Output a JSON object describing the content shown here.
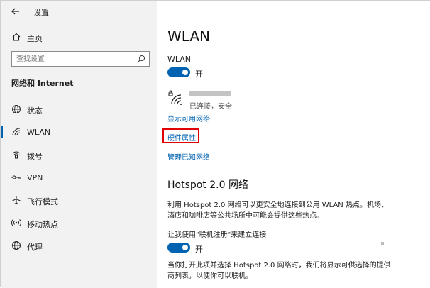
{
  "window": {
    "title": "设置"
  },
  "sidebar": {
    "home_label": "主页",
    "search_placeholder": "查找设置",
    "section_title": "网络和 Internet",
    "items": [
      {
        "label": "状态",
        "icon": "globe-icon"
      },
      {
        "label": "WLAN",
        "icon": "wifi-icon",
        "selected": true
      },
      {
        "label": "拨号",
        "icon": "dialup-icon"
      },
      {
        "label": "VPN",
        "icon": "vpn-icon"
      },
      {
        "label": "飞行模式",
        "icon": "airplane-icon"
      },
      {
        "label": "移动热点",
        "icon": "hotspot-icon"
      },
      {
        "label": "代理",
        "icon": "proxy-globe-icon"
      }
    ]
  },
  "main": {
    "page_title": "WLAN",
    "wlan_toggle_label": "WLAN",
    "wlan_toggle_state": "开",
    "network_status": "已连接，安全",
    "links": {
      "show_networks": "显示可用网络",
      "hardware_properties": "硬件属性",
      "manage_known": "管理已知网络"
    },
    "hotspot": {
      "heading": "Hotspot 2.0 网络",
      "description": "利用 Hotspot 2.0 网络可以更安全地连接到公用 WLAN 热点。机场、酒店和咖啡店等公共场所中可能会提供这些热点。",
      "toggle_label": "让我使用\"联机注册\"来建立连接",
      "toggle_state": "开",
      "footer": "当你打开此项并选择 Hotspot 2.0 网络时，我们将显示可供选择的提供商列表，以便你可以联机。"
    }
  },
  "colors": {
    "accent": "#0063b1",
    "highlight": "#e00000",
    "sidebar_bg": "#f2f2f2"
  }
}
